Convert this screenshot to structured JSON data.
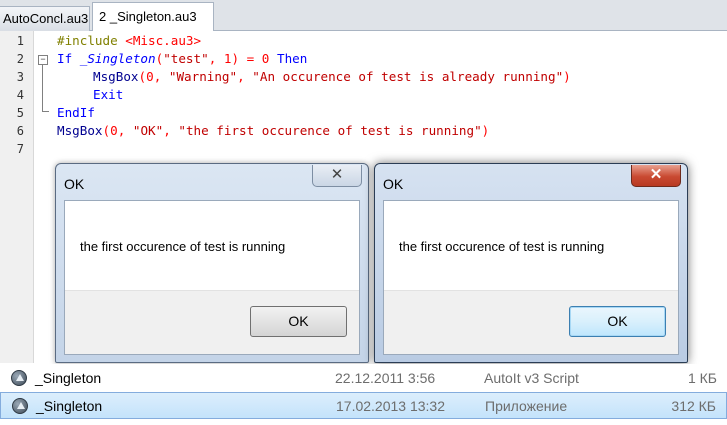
{
  "tabs": [
    {
      "label": "AutoConcl.au3",
      "active": false
    },
    {
      "label": "2 _Singleton.au3",
      "active": true
    }
  ],
  "editor": {
    "line_numbers": [
      "1",
      "2",
      "3",
      "4",
      "5",
      "6",
      "7"
    ],
    "lines": {
      "l1": {
        "directive": "#include",
        "path": "<Misc.au3>"
      },
      "l2": {
        "kw_if": "If",
        "func": "_Singleton",
        "open": "(",
        "arg1": "\"test\"",
        "comma": ", ",
        "arg2": "1",
        "close": ")",
        "eq": " = ",
        "zero": "0",
        "kw_then": "Then"
      },
      "l3": {
        "func": "MsgBox",
        "open": "(",
        "arg1": "0",
        "c1": ", ",
        "arg2": "\"Warning\"",
        "c2": ", ",
        "arg3": "\"An occurence of test is already running\"",
        "close": ")"
      },
      "l4": {
        "kw": "Exit"
      },
      "l5": {
        "kw": "EndIf"
      },
      "l6": {
        "func": "MsgBox",
        "open": "(",
        "arg1": "0",
        "c1": ", ",
        "arg2": "\"OK\"",
        "c2": ", ",
        "arg3": "\"the first occurence of test is running\"",
        "close": ")"
      }
    }
  },
  "dialogs": [
    {
      "title": "OK",
      "message": "the first occurence of test is running",
      "button": "OK",
      "close_glyph": "✕"
    },
    {
      "title": "OK",
      "message": "the first occurence of test is running",
      "button": "OK",
      "close_glyph": "✕"
    }
  ],
  "files": [
    {
      "name": "_Singleton",
      "date": "22.12.2011 3:56",
      "type": "AutoIt v3 Script",
      "size": "1 КБ"
    },
    {
      "name": "_Singleton",
      "date": "17.02.2013 13:32",
      "type": "Приложение",
      "size": "312 КБ"
    }
  ],
  "colors": {
    "keyword": "#0000ff",
    "string": "#c00000",
    "number": "#ff0000",
    "selection": "#c4e3fb",
    "close_active": "#c94a32"
  }
}
